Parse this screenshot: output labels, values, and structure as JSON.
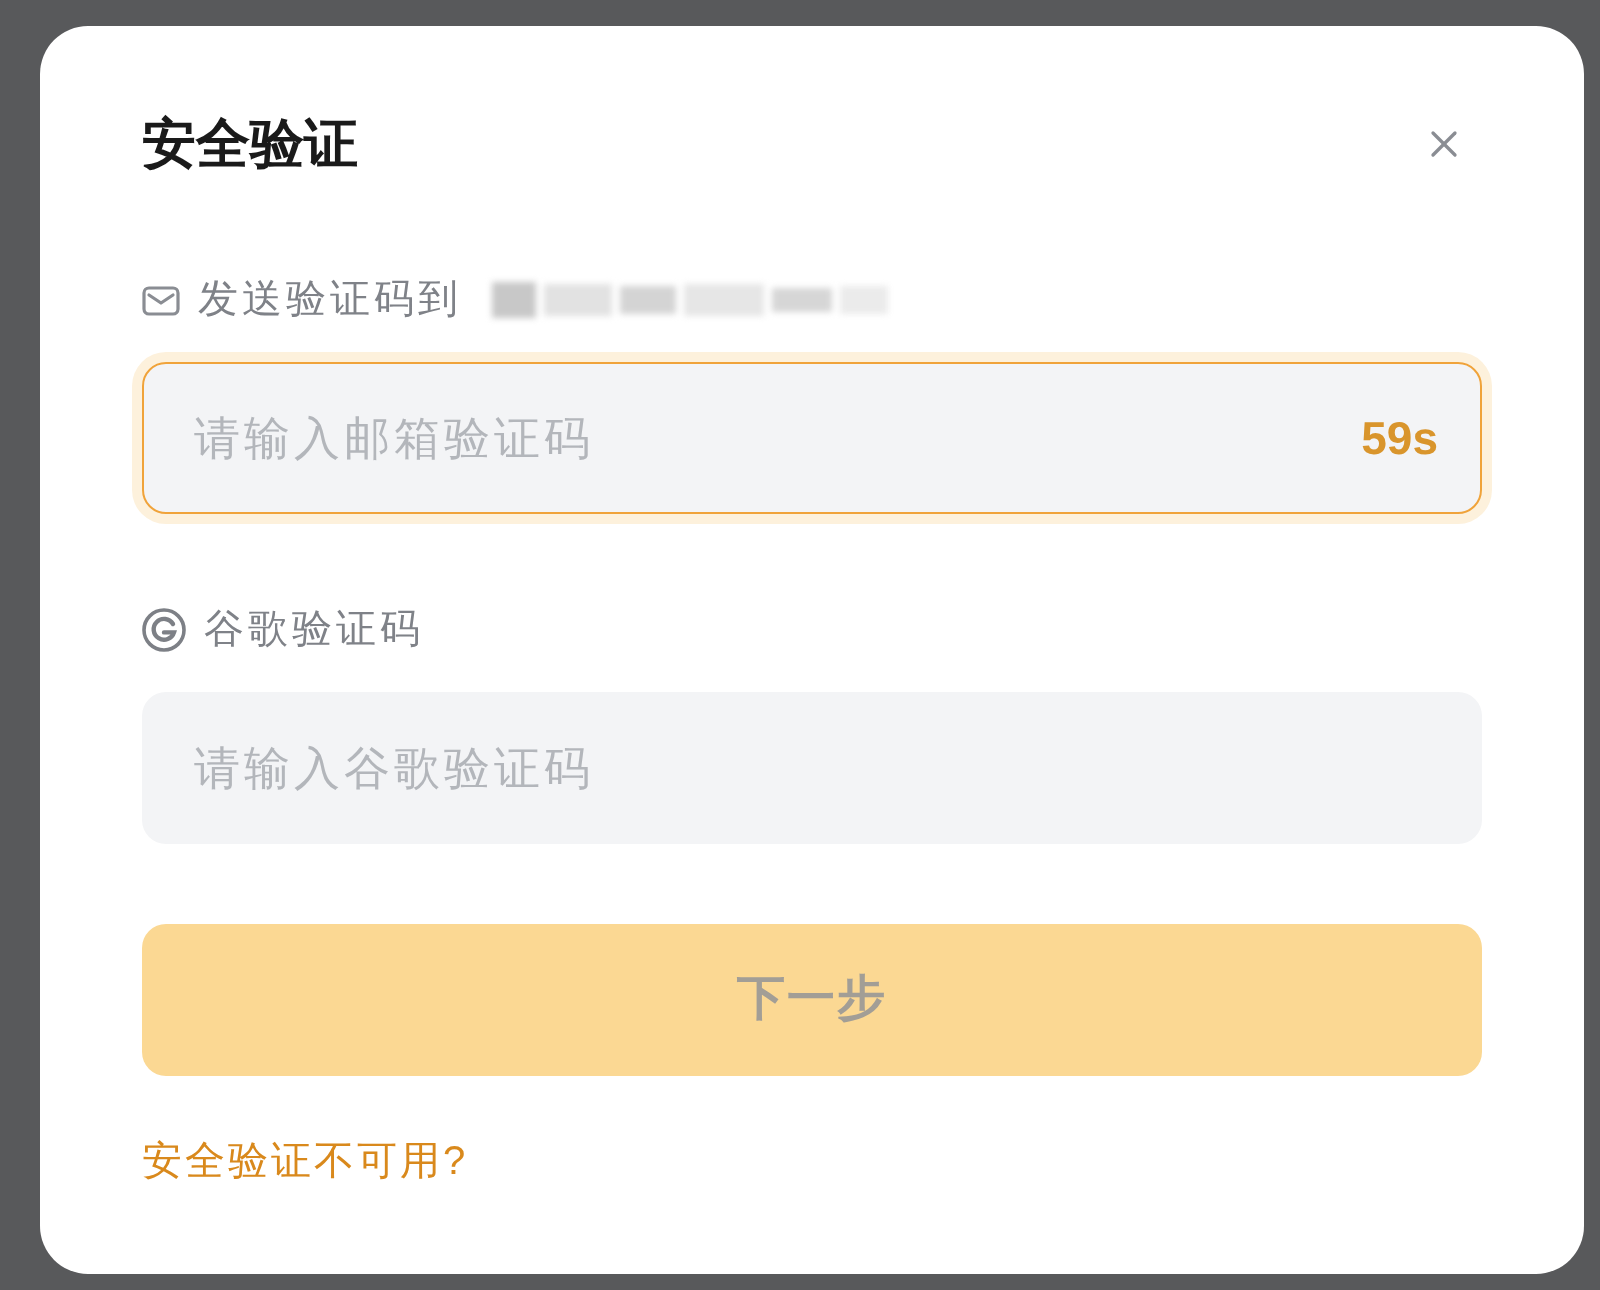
{
  "dialog": {
    "title": "安全验证"
  },
  "fields": [
    {
      "kind": "email",
      "label": "发送验证码到",
      "redacted": true,
      "placeholder": "请输入邮箱验证码",
      "countdown": "59s",
      "focused": true
    },
    {
      "kind": "google",
      "label": "谷歌验证码",
      "redacted": false,
      "placeholder": "请输入谷歌验证码",
      "focused": false
    }
  ],
  "next_button": {
    "label": "下一步",
    "disabled": true
  },
  "help_link": "安全验证不可用?"
}
